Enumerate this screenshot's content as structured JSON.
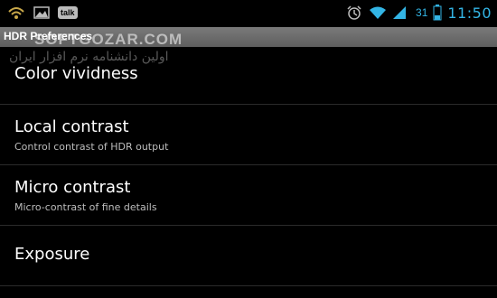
{
  "status_bar": {
    "left_icons": [
      "wifi-notification-icon",
      "image-icon",
      "talk-icon"
    ],
    "talk_label": "talk",
    "battery_level": "31",
    "clock": "11:50",
    "accent_color": "#33b5e5"
  },
  "title_bar": {
    "title": "HDR Preferences"
  },
  "watermark": {
    "latin": "SOFTGOZAR.COM",
    "persian": "اولین دانشنامه نرم افزار ایران"
  },
  "preferences": [
    {
      "title": "Color vividness",
      "summary": ""
    },
    {
      "title": "Local contrast",
      "summary": "Control contrast of HDR output"
    },
    {
      "title": "Micro contrast",
      "summary": "Micro-contrast of fine details"
    },
    {
      "title": "Exposure",
      "summary": ""
    }
  ]
}
